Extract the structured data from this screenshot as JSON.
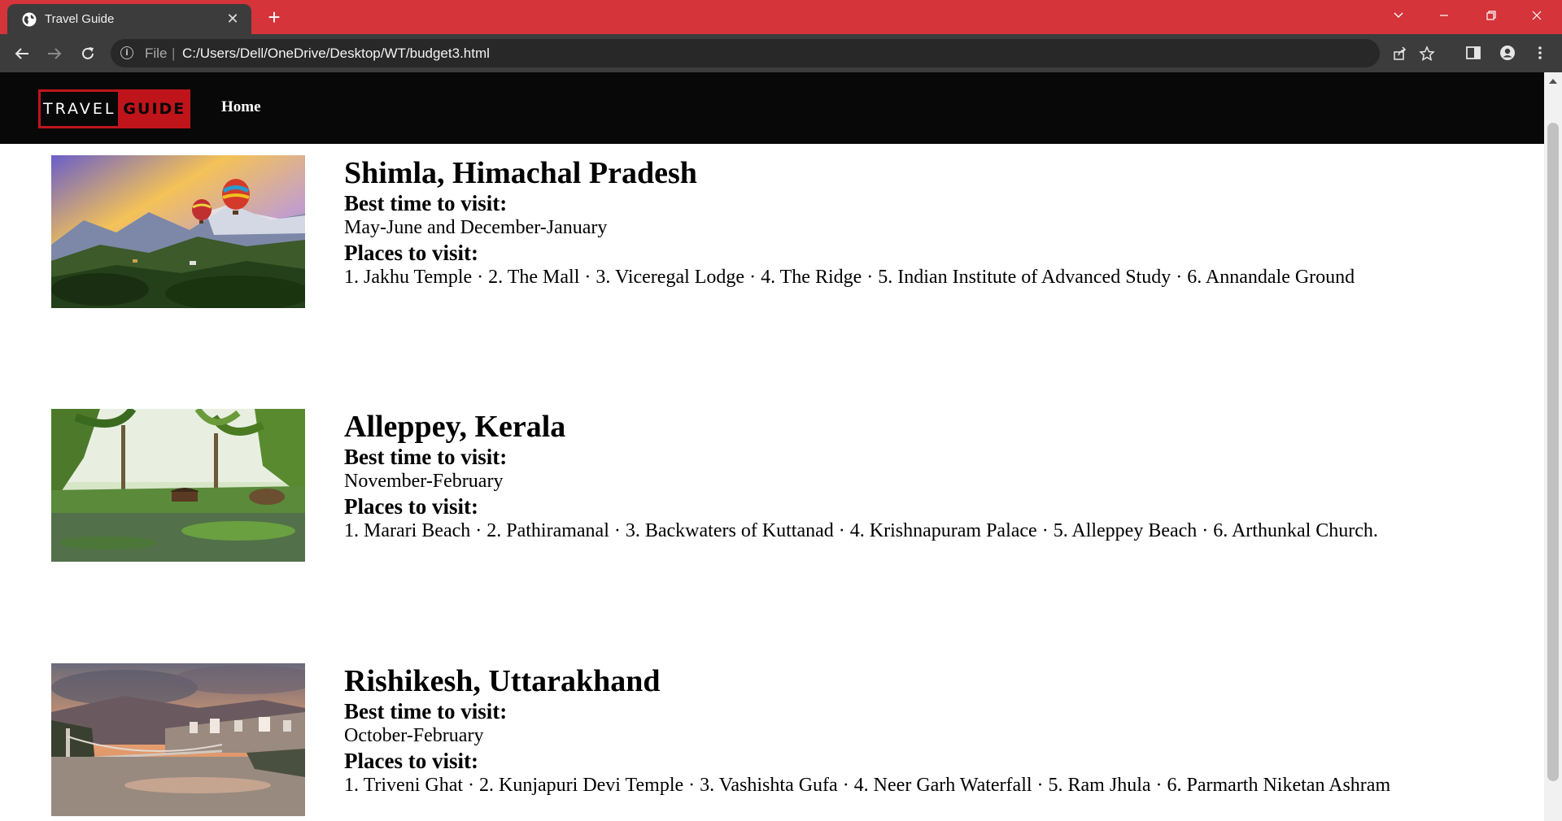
{
  "browser": {
    "tab_title": "Travel Guide",
    "tab_close": "✕",
    "new_tab": "+",
    "address_scheme": "File",
    "address_url": "C:/Users/Dell/OneDrive/Desktop/WT/budget3.html"
  },
  "site": {
    "logo_word1": "TRAVEL",
    "logo_word2": "GUIDE",
    "nav_home": "Home"
  },
  "destinations": [
    {
      "name": "Shimla, Himachal Pradesh",
      "best_time_label": "Best time to visit:",
      "best_time": "May-June and December-January",
      "places_label": "Places to visit:",
      "places": "1. Jakhu Temple · 2. The Mall · 3. Viceregal Lodge · 4. The Ridge · 5. Indian Institute of Advanced Study · 6. Annandale Ground"
    },
    {
      "name": "Alleppey, Kerala",
      "best_time_label": "Best time to visit:",
      "best_time": "November-February",
      "places_label": "Places to visit:",
      "places": "1. Marari Beach · 2. Pathiramanal · 3. Backwaters of Kuttanad · 4. Krishnapuram Palace · 5. Alleppey Beach · 6. Arthunkal Church."
    },
    {
      "name": "Rishikesh, Uttarakhand",
      "best_time_label": "Best time to visit:",
      "best_time": "October-February",
      "places_label": "Places to visit:",
      "places": "1. Triveni Ghat · 2. Kunjapuri Devi Temple · 3. Vashishta Gufa · 4. Neer Garh Waterfall · 5. Ram Jhula · 6. Parmarth Niketan Ashram"
    }
  ],
  "colors": {
    "tabstrip": "#d4343a",
    "toolbar": "#3c3c3c",
    "navbar": "#080808",
    "logo_accent": "#c0141b"
  }
}
